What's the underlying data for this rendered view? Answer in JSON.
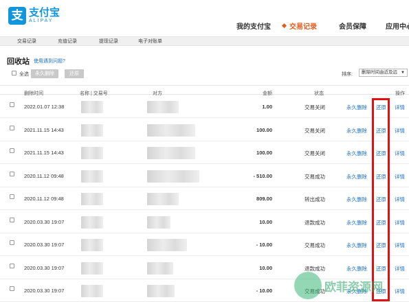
{
  "header": {
    "logo_mark": "支",
    "logo_cn": "支付宝",
    "logo_en": "ALIPAY",
    "nav": [
      {
        "label": "我的支付宝",
        "active": false
      },
      {
        "label": "交易记录",
        "active": true
      },
      {
        "label": "会员保障",
        "active": false
      },
      {
        "label": "应用中心",
        "active": false
      }
    ]
  },
  "subtabs": [
    "交易记录",
    "充值记录",
    "提现记录",
    "电子对账单"
  ],
  "page": {
    "title": "回收站",
    "help": "使用遇到问题?"
  },
  "toolbar": {
    "select_all": "全选",
    "delete_forever": "永久删除",
    "restore": "还原",
    "sort_label": "排序:",
    "sort_value": "删除时间由近及远"
  },
  "table": {
    "headers": {
      "time": "删除时间",
      "name": "名称 | 交易号",
      "party": "对方",
      "amount": "金额",
      "status": "状态",
      "ops": "操作"
    },
    "op_labels": {
      "delete": "永久删除",
      "restore": "还原",
      "detail": "详情"
    },
    "rows": [
      {
        "time": "2022.01.07 12:38",
        "amount": "1.00",
        "status": "交易关闭"
      },
      {
        "time": "2021.11.15 14:43",
        "amount": "100.00",
        "status": "交易关闭"
      },
      {
        "time": "2021.11.15 14:43",
        "amount": "100.00",
        "status": "交易关闭"
      },
      {
        "time": "2020.11.12 09:48",
        "amount": "- 510.00",
        "status": "交易成功"
      },
      {
        "time": "2020.11.12 09:48",
        "amount": "809.00",
        "status": "转出成功"
      },
      {
        "time": "2020.03.30 19:07",
        "amount": "10.00",
        "status": "退款成功"
      },
      {
        "time": "2020.03.30 19:07",
        "amount": "- 10.00",
        "status": "交易成功"
      },
      {
        "time": "2020.03.30 19:07",
        "amount": "10.00",
        "status": "退款成功"
      },
      {
        "time": "2020.03.30 19:07",
        "amount": "- 10.00",
        "status": "交易成功"
      }
    ]
  },
  "watermark": "欧菲资源网",
  "colors": {
    "brand": "#1296db",
    "accent": "#e85a1b",
    "link": "#1a6fbf",
    "highlight": "#e31010"
  }
}
